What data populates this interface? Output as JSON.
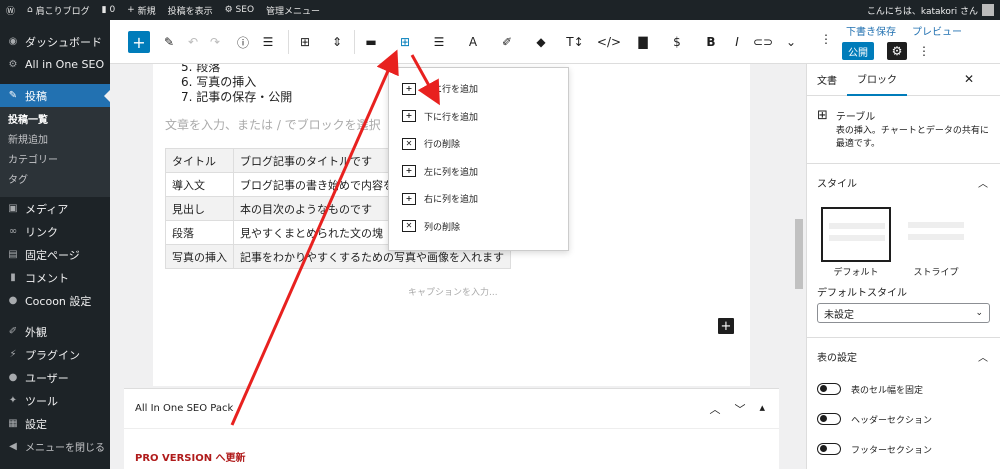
{
  "adminbar": {
    "site_name": "肩こりブログ",
    "comments_count": "0",
    "new_label": "新規",
    "view_post": "投稿を表示",
    "seo": "SEO",
    "admin_menu": "管理メニュー",
    "greeting": "こんにちは、katakori さん"
  },
  "sidebar": {
    "dashboard": "ダッシュボード",
    "aioseo": "All in One SEO",
    "posts": "投稿",
    "posts_sub": [
      "投稿一覧",
      "新規追加",
      "カテゴリー",
      "タグ"
    ],
    "media": "メディア",
    "links": "リンク",
    "pages": "固定ページ",
    "comments": "コメント",
    "cocoon": "Cocoon 設定",
    "appearance": "外観",
    "plugins": "プラグイン",
    "users": "ユーザー",
    "tools": "ツール",
    "settings": "設定",
    "collapse": "メニューを閉じる"
  },
  "header": {
    "save_draft": "下書き保存",
    "preview": "プレビュー",
    "publish": "公開",
    "toolbar_icons": [
      "add-block-icon",
      "edit-icon",
      "undo-icon",
      "redo-icon",
      "info-icon",
      "list-view-icon",
      "table-icon",
      "move-icon",
      "align-icon",
      "table-edit-icon",
      "text-align-icon",
      "font-icon",
      "marker-icon",
      "tag-icon",
      "text-size-icon",
      "code-icon",
      "document-icon",
      "dollar-icon",
      "bold-icon",
      "italic-icon",
      "link-icon",
      "more-icon"
    ]
  },
  "content": {
    "list_items": [
      "5. 段落",
      "6. 写真の挿入",
      "7. 記事の保存・公開"
    ],
    "placeholder": "文章を入力、または / でブロックを選択",
    "table_rows": [
      [
        "タイトル",
        "ブログ記事のタイトルです"
      ],
      [
        "導入文",
        "ブログ記事の書き始めで内容を"
      ],
      [
        "見出し",
        "本の目次のようなものです"
      ],
      [
        "段落",
        "見やすくまとめられた文の塊"
      ],
      [
        "写真の挿入",
        "記事をわかりやすくするための写真や画像を入れます"
      ]
    ],
    "caption_placeholder": "キャプションを入力..."
  },
  "table_menu": {
    "items": [
      "上に行を追加",
      "下に行を追加",
      "行の削除",
      "左に列を追加",
      "右に列を追加",
      "列の削除"
    ]
  },
  "metabox": {
    "title": "All In One SEO Pack",
    "pro_text": "PRO VERSION へ更新"
  },
  "settings_panel": {
    "tab_document": "文書",
    "tab_block": "ブロック",
    "block_name": "テーブル",
    "block_desc": "表の挿入。チャートとデータの共有に最適です。",
    "styles_title": "スタイル",
    "style_default": "デフォルト",
    "style_stripes": "ストライプ",
    "default_style_label": "デフォルトスタイル",
    "default_style_value": "未設定",
    "table_settings_title": "表の設定",
    "toggles": [
      "表のセル幅を固定",
      "ヘッダーセクション",
      "フッターセクション"
    ]
  },
  "colors": {
    "accent": "#007cba",
    "admin_dark": "#1d2327",
    "annotation_arrow": "#e8211f"
  }
}
